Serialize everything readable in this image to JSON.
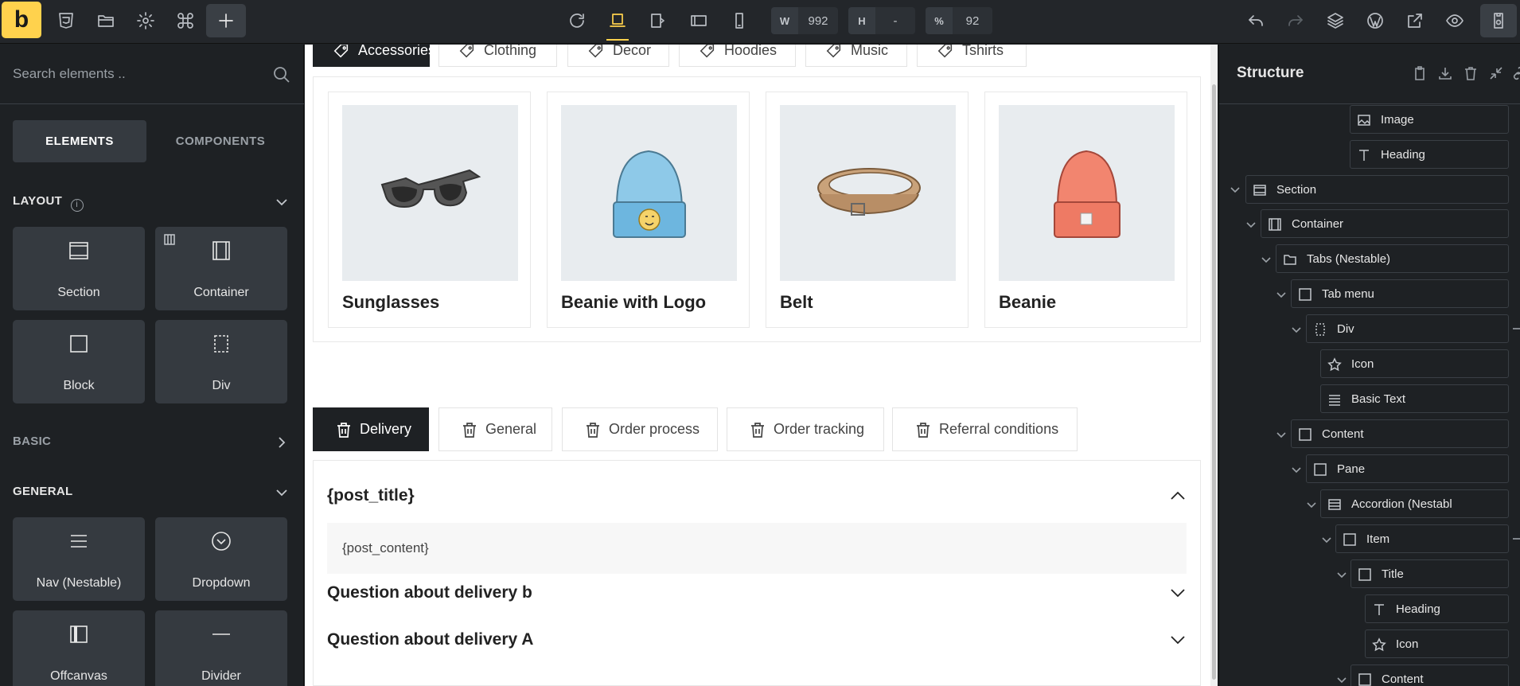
{
  "topbar": {
    "logo": "b",
    "width_label": "W",
    "width_value": "992",
    "height_label": "H",
    "height_value": "-",
    "zoom_label": "%",
    "zoom_value": "92"
  },
  "left": {
    "search_placeholder": "Search elements ..",
    "tab_elements": "ELEMENTS",
    "tab_components": "COMPONENTS",
    "cat_layout": "LAYOUT",
    "cat_basic": "BASIC",
    "cat_general": "GENERAL",
    "layout_items": [
      "Section",
      "Container",
      "Block",
      "Div"
    ],
    "general_items": [
      "Nav (Nestable)",
      "Dropdown",
      "Offcanvas",
      "Divider"
    ]
  },
  "canvas": {
    "category_tabs": [
      "Accessories",
      "Clothing",
      "Decor",
      "Hoodies",
      "Music",
      "Tshirts"
    ],
    "products": [
      "Sunglasses",
      "Beanie with Logo",
      "Belt",
      "Beanie"
    ],
    "faq_tabs": [
      "Delivery",
      "General",
      "Order process",
      "Order tracking",
      "Referral conditions"
    ],
    "acc_title_1": "{post_title}",
    "acc_content_1": "{post_content}",
    "acc_title_2": "Question about delivery b",
    "acc_title_3": "Question about delivery A"
  },
  "structure": {
    "title": "Structure",
    "nodes": [
      "Image",
      "Heading",
      "Section",
      "Container",
      "Tabs (Nestable)",
      "Tab menu",
      "Div",
      "Icon",
      "Basic Text",
      "Content",
      "Pane",
      "Accordion (Nestabl",
      "Item",
      "Title",
      "Heading",
      "Icon",
      "Content"
    ]
  },
  "colors": {
    "accent": "#ffd24d",
    "panel_bg": "#1e2124",
    "tile_bg": "#353a40"
  }
}
